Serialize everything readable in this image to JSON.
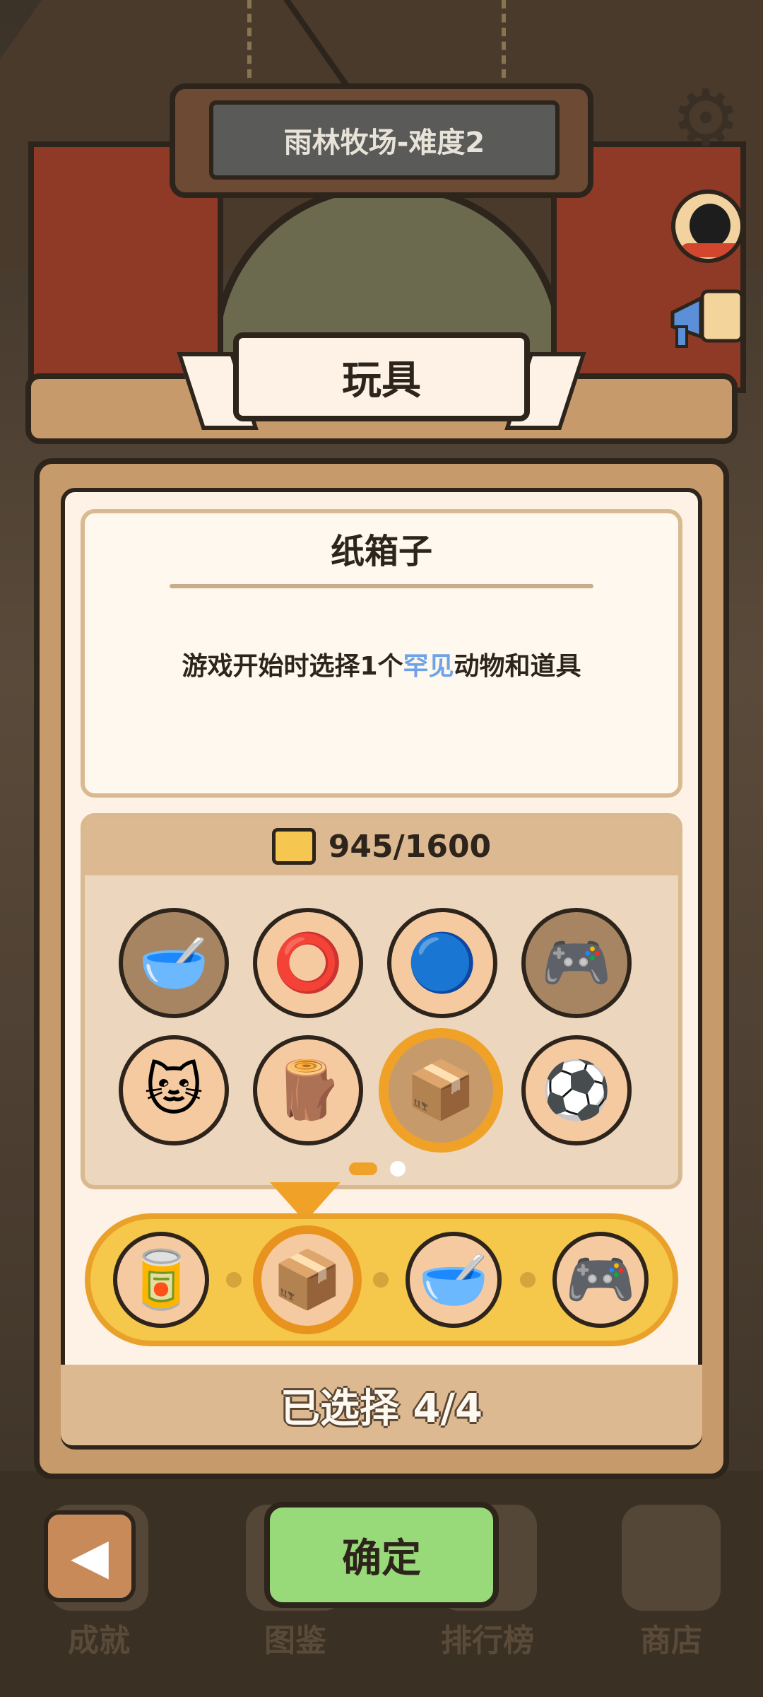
{
  "header": {
    "level_title": "雨林牧场-难度2"
  },
  "icons": {
    "settings": "gear-icon",
    "profile": "penguin-avatar-icon",
    "announce": "megaphone-icon"
  },
  "panel": {
    "title": "玩具",
    "item_name": "纸箱子",
    "desc_before": "游戏开始时选择1个",
    "desc_highlight": "罕见",
    "desc_after": "动物和道具",
    "highlight_color": "#6fa3e8"
  },
  "inventory": {
    "count": "945/1600",
    "items": [
      {
        "name": "cat-bowl-icon",
        "glyph": "🥣",
        "owned": false
      },
      {
        "name": "pet-collar-icon",
        "glyph": "⭕",
        "owned": true
      },
      {
        "name": "spinning-toy-icon",
        "glyph": "🔵",
        "owned": true
      },
      {
        "name": "game-console-icon",
        "glyph": "🎮",
        "owned": false
      },
      {
        "name": "cat-doll-icon",
        "glyph": "🐱",
        "owned": true
      },
      {
        "name": "cat-tree-icon",
        "glyph": "🪵",
        "owned": true
      },
      {
        "name": "cardboard-box-icon",
        "glyph": "📦",
        "owned": true,
        "selected": true
      },
      {
        "name": "balls-icon",
        "glyph": "⚽",
        "owned": true
      }
    ],
    "page": 1,
    "pages": 2
  },
  "selection": {
    "slots": [
      {
        "name": "food-can-icon",
        "glyph": "🥫"
      },
      {
        "name": "cardboard-box-icon",
        "glyph": "📦",
        "current": true
      },
      {
        "name": "cat-bowl-icon",
        "glyph": "🥣"
      },
      {
        "name": "game-console-icon",
        "glyph": "🎮"
      }
    ],
    "status": "已选择 4/4"
  },
  "nav": {
    "achievements": "成就",
    "collection": "图鉴",
    "leaderboard": "排行榜",
    "shop": "商店",
    "confirm": "确定",
    "back_icon": "back-arrow-icon"
  }
}
